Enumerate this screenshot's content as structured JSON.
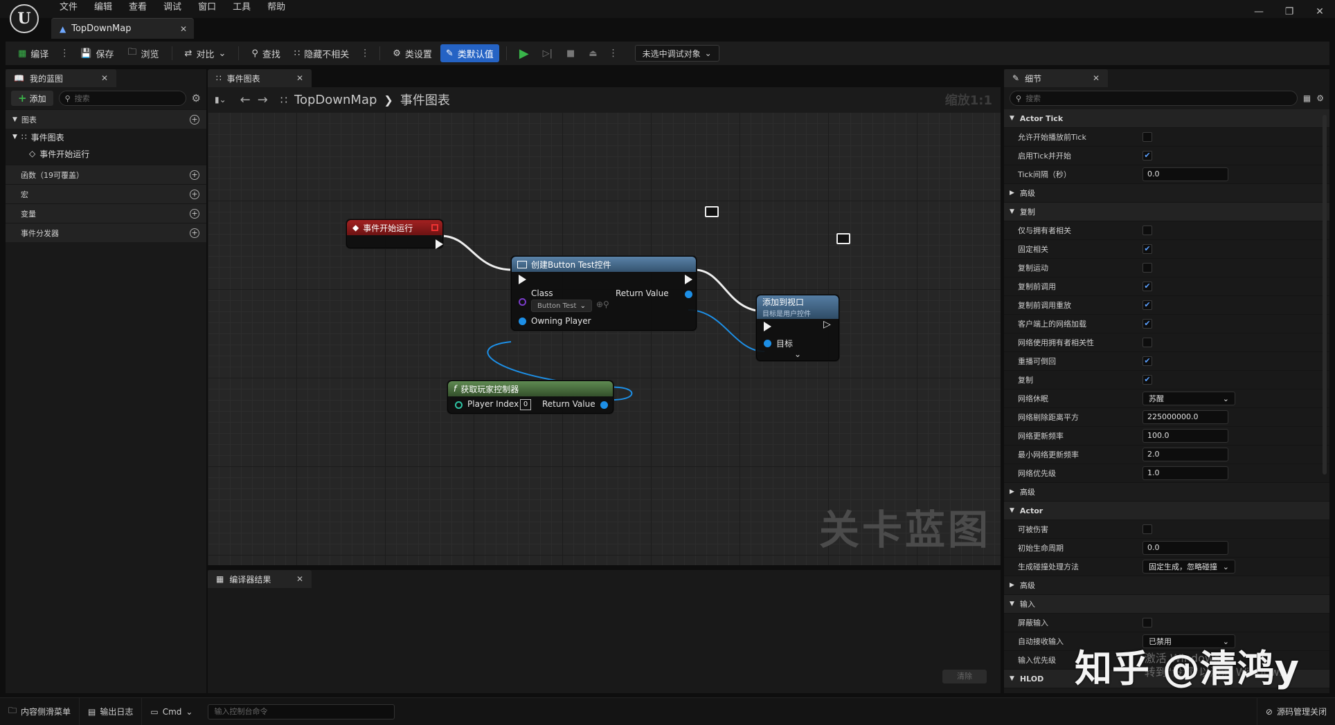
{
  "menu": [
    "文件",
    "编辑",
    "查看",
    "调试",
    "窗口",
    "工具",
    "帮助"
  ],
  "doc_tab": {
    "label": "TopDownMap"
  },
  "toolbar": {
    "compile": "编译",
    "save": "保存",
    "browse": "浏览",
    "diff": "对比",
    "find": "查找",
    "hide_unrelated": "隐藏不相关",
    "class_settings": "类设置",
    "class_defaults": "类默认值",
    "debug_dropdown": "未选中调试对象"
  },
  "left_panel": {
    "tab": "我的蓝图",
    "add": "添加",
    "search_placeholder": "搜索",
    "graphs_header": "图表",
    "event_graph": "事件图表",
    "begin_play": "事件开始运行",
    "functions": "函数（19可覆盖）",
    "macros": "宏",
    "variables": "变量",
    "dispatchers": "事件分发器"
  },
  "graph": {
    "tab": "事件图表",
    "breadcrumb_root": "TopDownMap",
    "breadcrumb_leaf": "事件图表",
    "zoom": "缩放1:1",
    "watermark": "关卡蓝图",
    "nodes": {
      "begin_play": {
        "title": "事件开始运行"
      },
      "create_widget": {
        "title": "创建Button Test控件",
        "class_label": "Class",
        "class_value": "Button Test",
        "owning_player": "Owning Player",
        "return_value": "Return Value"
      },
      "add_to_viewport": {
        "title": "添加到视口",
        "subtitle": "目标是用户控件",
        "target": "目标"
      },
      "get_player_controller": {
        "title": "获取玩家控制器",
        "player_index": "Player Index",
        "player_index_value": "0",
        "return_value": "Return Value"
      }
    }
  },
  "compiler": {
    "tab": "编译器结果",
    "clear": "清除"
  },
  "details": {
    "tab": "细节",
    "search_placeholder": "搜索",
    "sections": [
      {
        "type": "cat",
        "label": "Actor Tick",
        "bold": true
      },
      {
        "type": "check",
        "label": "允许开始播放前Tick",
        "checked": false
      },
      {
        "type": "check",
        "label": "启用Tick并开始",
        "checked": true
      },
      {
        "type": "num",
        "label": "Tick间隔（秒）",
        "value": "0.0"
      },
      {
        "type": "adv",
        "label": "高级"
      },
      {
        "type": "cat",
        "label": "复制"
      },
      {
        "type": "check",
        "label": "仅与拥有者相关",
        "checked": false
      },
      {
        "type": "check",
        "label": "固定相关",
        "checked": true
      },
      {
        "type": "check",
        "label": "复制运动",
        "checked": false
      },
      {
        "type": "check",
        "label": "复制前调用",
        "checked": true
      },
      {
        "type": "check",
        "label": "复制前调用重放",
        "checked": true
      },
      {
        "type": "check",
        "label": "客户端上的网络加载",
        "checked": true
      },
      {
        "type": "check",
        "label": "网络使用拥有者相关性",
        "checked": false
      },
      {
        "type": "check",
        "label": "重播可倒回",
        "checked": true
      },
      {
        "type": "check",
        "label": "复制",
        "checked": true
      },
      {
        "type": "dd",
        "label": "网络休眠",
        "value": "苏醒"
      },
      {
        "type": "num",
        "label": "网络剔除距离平方",
        "value": "225000000.0"
      },
      {
        "type": "num",
        "label": "网络更新频率",
        "value": "100.0"
      },
      {
        "type": "num",
        "label": "最小网络更新频率",
        "value": "2.0"
      },
      {
        "type": "num",
        "label": "网络优先级",
        "value": "1.0"
      },
      {
        "type": "adv",
        "label": "高级"
      },
      {
        "type": "cat",
        "label": "Actor",
        "bold": true
      },
      {
        "type": "check",
        "label": "可被伤害",
        "checked": false
      },
      {
        "type": "num",
        "label": "初始生命周期",
        "value": "0.0"
      },
      {
        "type": "dd",
        "label": "生成碰撞处理方法",
        "value": "固定生成，忽略碰撞"
      },
      {
        "type": "adv",
        "label": "高级"
      },
      {
        "type": "cat",
        "label": "输入"
      },
      {
        "type": "check",
        "label": "屏蔽输入",
        "checked": false
      },
      {
        "type": "dd",
        "label": "自动接收输入",
        "value": "已禁用"
      },
      {
        "type": "text",
        "label": "输入优先级",
        "value": ""
      },
      {
        "type": "cat",
        "label": "HLOD",
        "bold": true
      }
    ]
  },
  "statusbar": {
    "content_drawer": "内容侧滑菜单",
    "output_log": "输出日志",
    "cmd": "Cmd",
    "cmd_placeholder": "输入控制台命令",
    "source_control": "源码管理关闭"
  },
  "overlay": {
    "zhihu": "知乎 @清鸿y",
    "activate_line1": "激活 Windows",
    "activate_line2": "转到\"设置\"以激活 Windows。"
  },
  "colors": {
    "accent": "#2563c4",
    "event_red": "#9b1c1c",
    "function_blue": "#4f7ea6",
    "pure_green": "#4e7a43",
    "play_green": "#39b54a"
  }
}
